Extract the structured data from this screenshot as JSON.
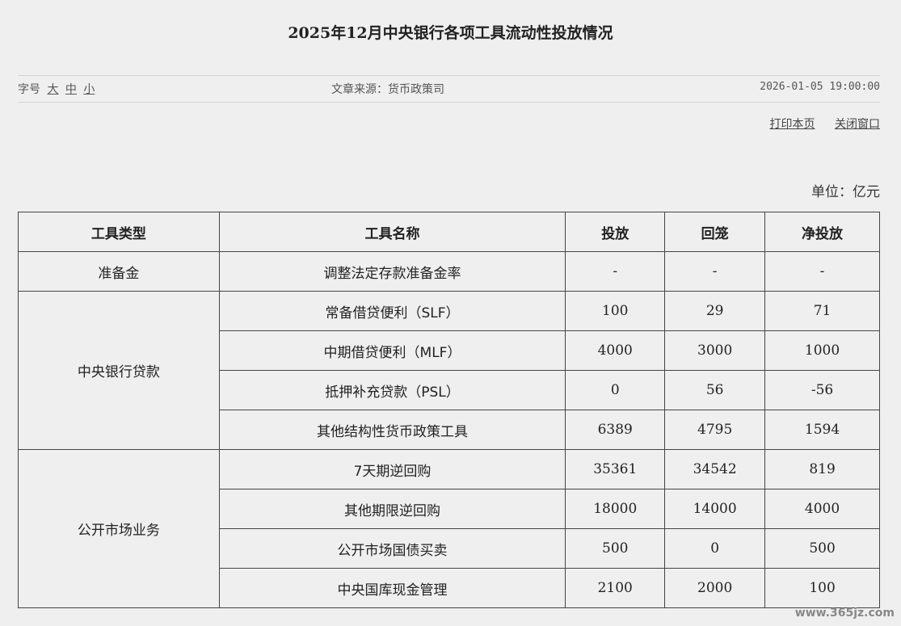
{
  "article": {
    "title": "2025年12月中央银行各项工具流动性投放情况",
    "font_size_label": "字号",
    "font_size_options": [
      "大",
      "中",
      "小"
    ],
    "source": "文章来源：货币政策司",
    "date": "2026-01-05 19:00:00"
  },
  "actions": {
    "print": "打印本页",
    "close": "关闭窗口"
  },
  "unit": "单位：亿元",
  "table": {
    "headers": [
      "工具类型",
      "工具名称",
      "投放",
      "回笼",
      "净投放"
    ],
    "groups": [
      {
        "type": "准备金",
        "rows": [
          {
            "name": "调整法定存款准备金率",
            "put": "-",
            "withdraw": "-",
            "net": "-"
          }
        ]
      },
      {
        "type": "中央银行贷款",
        "rows": [
          {
            "name": "常备借贷便利（SLF）",
            "put": "100",
            "withdraw": "29",
            "net": "71"
          },
          {
            "name": "中期借贷便利（MLF）",
            "put": "4000",
            "withdraw": "3000",
            "net": "1000"
          },
          {
            "name": "抵押补充贷款（PSL）",
            "put": "0",
            "withdraw": "56",
            "net": "-56"
          },
          {
            "name": "其他结构性货币政策工具",
            "put": "6389",
            "withdraw": "4795",
            "net": "1594"
          }
        ]
      },
      {
        "type": "公开市场业务",
        "rows": [
          {
            "name": "7天期逆回购",
            "put": "35361",
            "withdraw": "34542",
            "net": "819"
          },
          {
            "name": "其他期限逆回购",
            "put": "18000",
            "withdraw": "14000",
            "net": "4000"
          },
          {
            "name": "公开市场国债买卖",
            "put": "500",
            "withdraw": "0",
            "net": "500"
          },
          {
            "name": "中央国库现金管理",
            "put": "2100",
            "withdraw": "2000",
            "net": "100"
          }
        ]
      }
    ]
  },
  "watermark": "www.365jz.com"
}
